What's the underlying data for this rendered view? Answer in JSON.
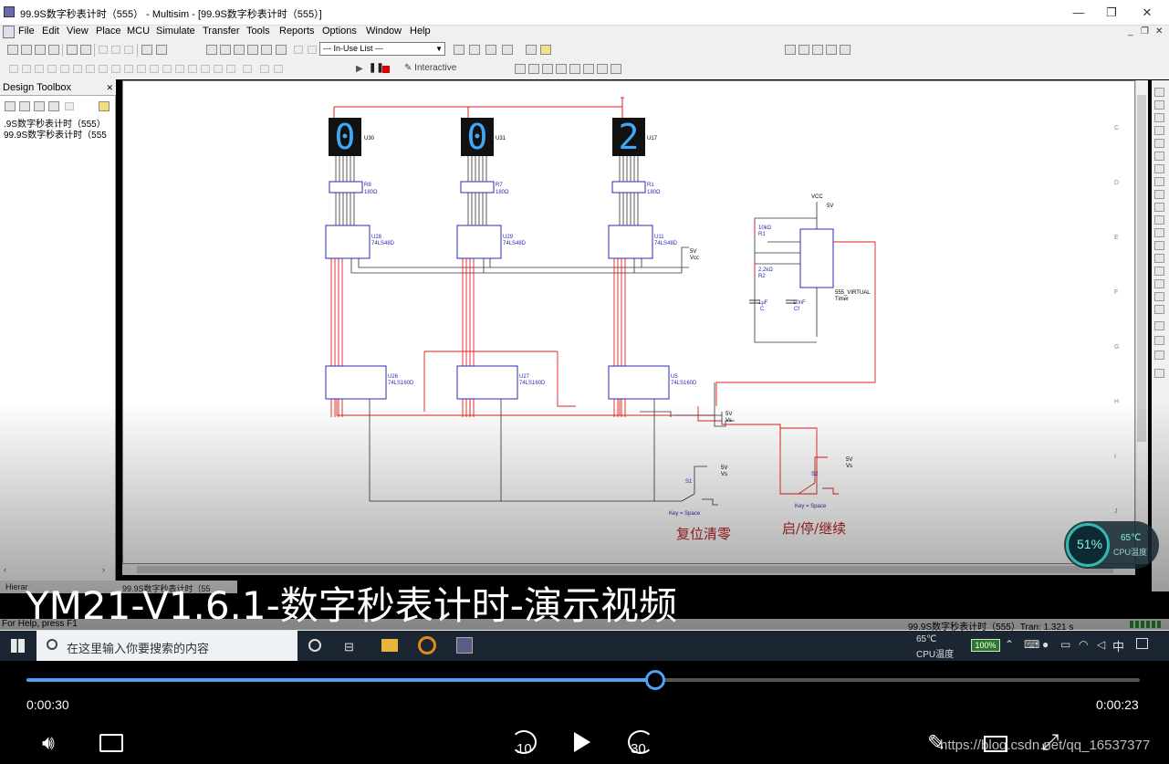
{
  "window": {
    "title": "99.9S数字秒表计时（555） - Multisim - [99.9S数字秒表计时（555）]",
    "min": "—",
    "restore": "❐",
    "close": "✕"
  },
  "menu": {
    "items": [
      "File",
      "Edit",
      "View",
      "Place",
      "MCU",
      "Simulate",
      "Transfer",
      "Tools",
      "Reports",
      "Options",
      "Window",
      "Help"
    ]
  },
  "toolbar": {
    "inuse_list": "--- In-Use List ---",
    "interactive": "Interactive"
  },
  "toolbox": {
    "title": "Design Toolbox",
    "items": [
      ".9S数字秒表计时（555）",
      "99.9S数字秒表计时（555"
    ]
  },
  "schematic": {
    "digits": [
      {
        "ref": "U30",
        "value": "0",
        "res": "R8",
        "res_val": "180Ω",
        "dec": "U28",
        "dec_part": "74LS48D",
        "cnt": "U26",
        "cnt_part": "74LS160D"
      },
      {
        "ref": "U31",
        "value": "0",
        "res": "R7",
        "res_val": "180Ω",
        "dec": "U29",
        "dec_part": "74LS48D",
        "cnt": "U27",
        "cnt_part": "74LS160D"
      },
      {
        "ref": "U17",
        "value": "2",
        "res": "R1",
        "res_val": "180Ω",
        "dec": "U11",
        "dec_part": "74LS48D",
        "cnt": "U5",
        "cnt_part": "74LS160D"
      }
    ],
    "vcc_5v": "5V",
    "vcc_label": "Vcc",
    "vs_5v": "5V",
    "vs_label": "Vs",
    "timer": {
      "vcc": "VCC",
      "vcc_v": "5V",
      "r1": "10kΩ",
      "r1_name": "R1",
      "r2": "2.2kΩ",
      "r2_name": "R2",
      "c": "1μF",
      "c_name": "C",
      "cf": "10nF",
      "cf_name": "Cf",
      "part": "555_VIRTUAL",
      "kind": "Timer"
    },
    "switches": [
      {
        "name": "S1",
        "key": "Key = Space",
        "caption": "复位清零"
      },
      {
        "name": "S2",
        "key": "Key = Space",
        "caption": "启/停/继续"
      }
    ]
  },
  "gauge": {
    "percent": "51%",
    "temp": "65℃",
    "label": "CPU温度",
    "level": 0.51
  },
  "overlay": {
    "title": "YM21-V1.6.1-数字秒表计时-演示视频"
  },
  "bottom": {
    "hier_tab": "Hierar",
    "file_tab": "99.9S数字秒表计时（55"
  },
  "status": {
    "help": "For Help, press F1",
    "file": "99.9S数字秒表计时（555）Tran: 1.321 s"
  },
  "taskbar": {
    "search_placeholder": "在这里输入你要搜索的内容",
    "temp": "65℃",
    "temp_label": "CPU温度",
    "battery": "100%",
    "ime": "中"
  },
  "player": {
    "elapsed": "0:00:30",
    "remaining": "0:00:23",
    "progress": 0.565,
    "skip_back": "10",
    "skip_fwd": "30",
    "watermark": "https://blog.csdn.net/qq_16537377"
  }
}
